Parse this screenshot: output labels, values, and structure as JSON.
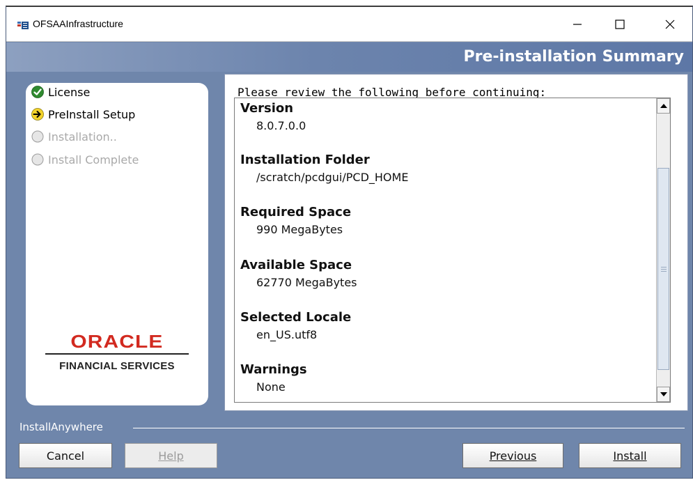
{
  "window": {
    "title": "OFSAAInfrastructure",
    "controls": {
      "minimize": "—",
      "maximize": "☐",
      "close": "✕"
    }
  },
  "header": {
    "title": "Pre-installation Summary"
  },
  "steps": [
    {
      "label": "License",
      "state": "done",
      "icon": "check-icon"
    },
    {
      "label": "PreInstall Setup",
      "state": "current",
      "icon": "arrow-right-icon"
    },
    {
      "label": "Installation..",
      "state": "pending",
      "icon": "circle-icon"
    },
    {
      "label": "Install Complete",
      "state": "pending",
      "icon": "circle-icon"
    }
  ],
  "branding": {
    "logo": "ORACLE",
    "subtitle": "FINANCIAL SERVICES"
  },
  "content": {
    "prompt": "Please review the following before continuing:",
    "fields": [
      {
        "label": "Version",
        "value": "8.0.7.0.0"
      },
      {
        "label": "Installation Folder",
        "value": "/scratch/pcdgui/PCD_HOME"
      },
      {
        "label": "Required Space",
        "value": "990 MegaBytes"
      },
      {
        "label": "Available Space",
        "value": "62770 MegaBytes"
      },
      {
        "label": "Selected Locale",
        "value": "en_US.utf8"
      },
      {
        "label": "Warnings",
        "value": "None"
      }
    ]
  },
  "footer": {
    "label": "InstallAnywhere",
    "buttons": {
      "cancel": "Cancel",
      "help": "Help",
      "previous": "Previous",
      "install": "Install"
    }
  },
  "colors": {
    "window_bg": "#6f86ab",
    "header_gradient_end": "#5d77a6",
    "oracle_red": "#d22a20",
    "check_green": "#2f8a2f",
    "arrow_yellow": "#f2d22b"
  }
}
